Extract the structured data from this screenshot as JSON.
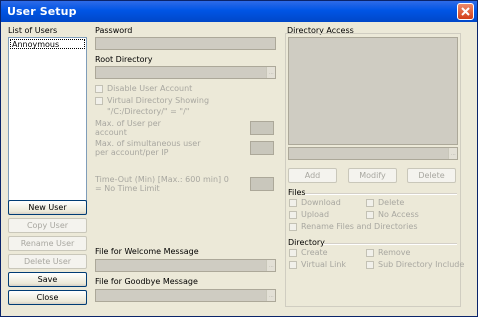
{
  "window": {
    "title": "User Setup"
  },
  "users": {
    "label": "List of Users",
    "items": [
      "Annoymous"
    ],
    "buttons": {
      "new": "New User",
      "copy": "Copy User",
      "rename": "Rename User",
      "delete": "Delete User",
      "save": "Save",
      "close": "Close"
    }
  },
  "account": {
    "password_label": "Password",
    "root_label": "Root Directory",
    "disable": "Disable User Account",
    "virtual": "Virtual Directory Showing",
    "virtual_hint": "\"/C:/Directory/\" = \"/\"",
    "max_user": "Max. of User per account",
    "max_simul": "Max. of simultaneous user per account/per IP",
    "timeout": "Time-Out (Min) [Max.: 600 min] 0 = No Time Limit",
    "welcome_label": "File for Welcome Message",
    "goodbye_label": "File for Goodbye Message"
  },
  "access": {
    "label": "Directory Access",
    "buttons": {
      "add": "Add",
      "modify": "Modify",
      "delete": "Delete"
    },
    "files_label": "Files",
    "files": {
      "download": "Download",
      "delete": "Delete",
      "upload": "Upload",
      "no_access": "No Access",
      "rename": "Rename Files and Directories"
    },
    "dir_label": "Directory",
    "dir": {
      "create": "Create",
      "remove": "Remove",
      "virtual": "Virtual Link",
      "subdir": "Sub Directory Include"
    }
  }
}
